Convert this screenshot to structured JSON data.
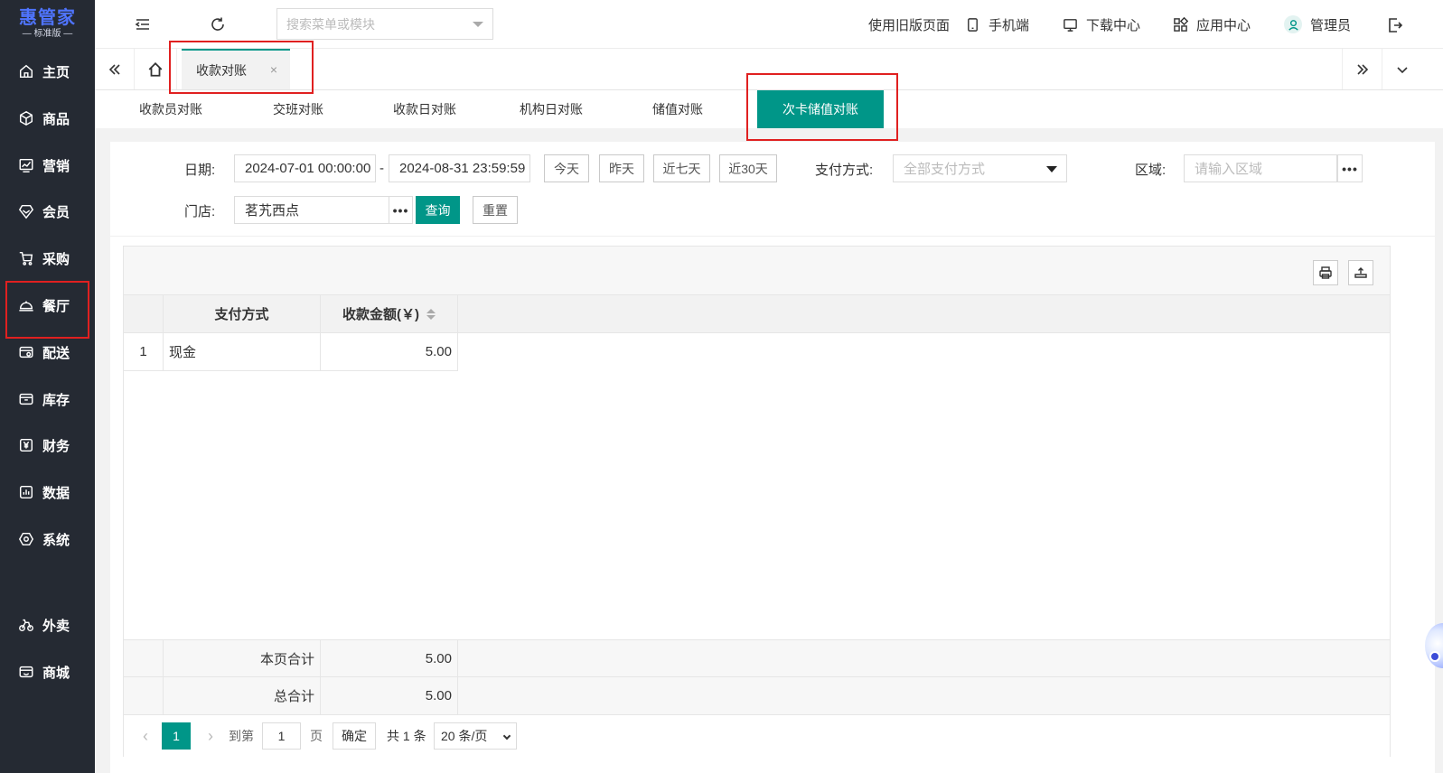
{
  "sidebar": {
    "logo": {
      "main": "惠管家",
      "sub": "— 标准版 —"
    },
    "items": [
      {
        "label": "主页",
        "icon": "home-icon"
      },
      {
        "label": "商品",
        "icon": "box-icon"
      },
      {
        "label": "营销",
        "icon": "chart-icon"
      },
      {
        "label": "会员",
        "icon": "diamond-icon"
      },
      {
        "label": "采购",
        "icon": "cart-icon"
      },
      {
        "label": "餐厅",
        "icon": "cloche-icon"
      },
      {
        "label": "配送",
        "icon": "delivery-icon"
      },
      {
        "label": "库存",
        "icon": "warehouse-icon"
      },
      {
        "label": "财务",
        "icon": "yuan-icon"
      },
      {
        "label": "数据",
        "icon": "bar-chart-icon"
      },
      {
        "label": "系统",
        "icon": "settings-icon"
      },
      {
        "label": "外卖",
        "icon": "bike-icon"
      },
      {
        "label": "商城",
        "icon": "shop-icon"
      }
    ]
  },
  "header": {
    "search_placeholder": "搜索菜单或模块",
    "links": [
      {
        "label": "使用旧版页面"
      },
      {
        "label": "手机端",
        "icon": "phone-icon"
      },
      {
        "label": "下载中心",
        "icon": "monitor-icon"
      },
      {
        "label": "应用中心",
        "icon": "apps-icon"
      },
      {
        "label": "管理员",
        "icon": "user-icon"
      }
    ]
  },
  "tabbar": {
    "active_tab": "收款对账",
    "close_symbol": "×"
  },
  "subtabs": [
    {
      "label": "收款员对账"
    },
    {
      "label": "交班对账"
    },
    {
      "label": "收款日对账"
    },
    {
      "label": "机构日对账"
    },
    {
      "label": "储值对账"
    },
    {
      "label": "次卡储值对账",
      "active": true
    }
  ],
  "filters": {
    "date_label": "日期:",
    "date_start": "2024-07-01 00:00:00",
    "date_sep": "-",
    "date_end": "2024-08-31 23:59:59",
    "quick_dates": [
      "今天",
      "昨天",
      "近七天",
      "近30天"
    ],
    "pay_label": "支付方式:",
    "pay_value": "全部支付方式",
    "area_label": "区域:",
    "area_placeholder": "请输入区域",
    "store_label": "门店:",
    "store_value": "茗艽西点",
    "more": "•••",
    "query_button": "查询",
    "reset_button": "重置"
  },
  "table": {
    "columns": [
      "支付方式",
      "收款金额(￥)"
    ],
    "rows": [
      {
        "index": "1",
        "method": "现金",
        "amount": "5.00"
      }
    ],
    "page_total_label": "本页合计",
    "page_total": "5.00",
    "grand_total_label": "总合计",
    "grand_total": "5.00"
  },
  "pager": {
    "current_page": "1",
    "goto_label": "到第",
    "goto_value": "1",
    "page_unit": "页",
    "confirm": "确定",
    "total": "共 1 条",
    "page_size": "20 条/页"
  },
  "colors": {
    "accent": "#009688",
    "sidebar_bg": "#252a33",
    "logo": "#4f74ff",
    "highlight": "#e02020"
  }
}
